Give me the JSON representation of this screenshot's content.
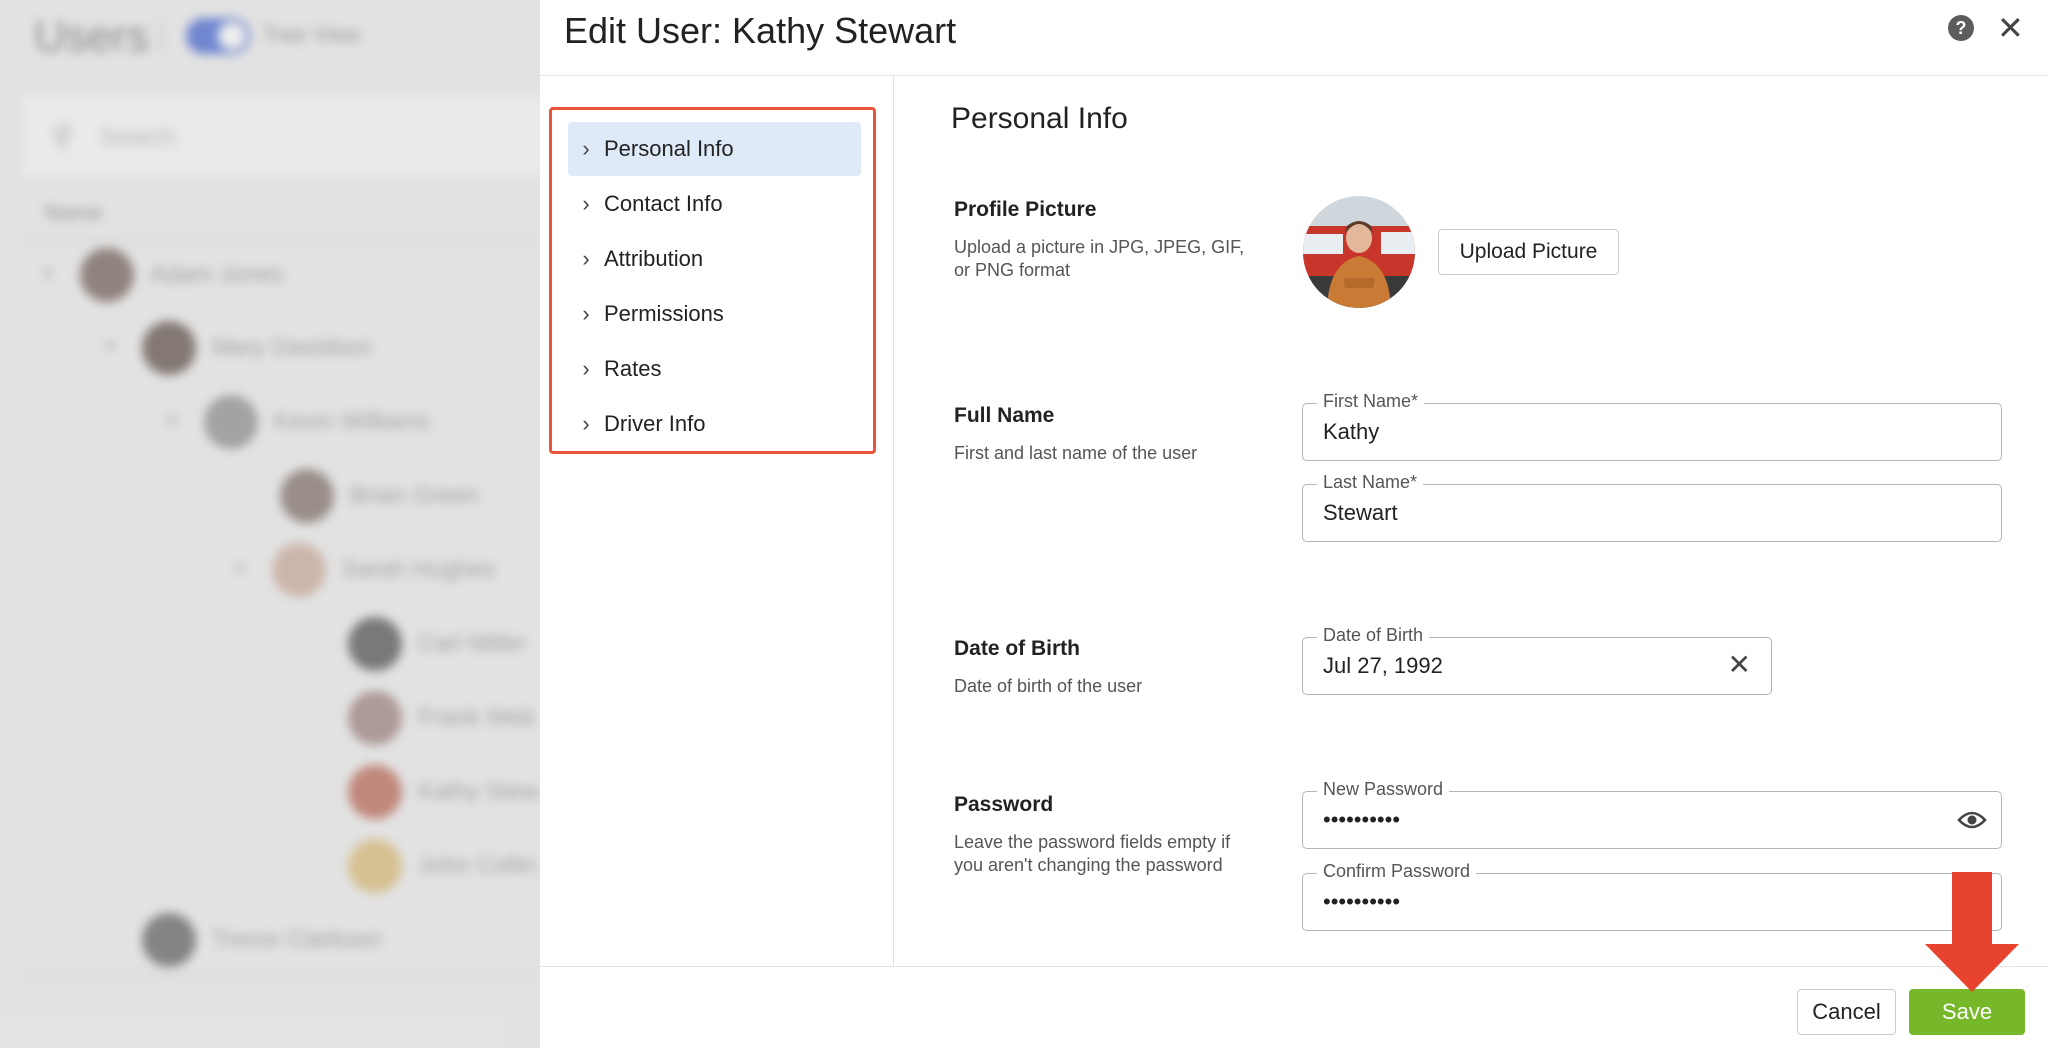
{
  "background": {
    "title": "Users",
    "toggle_label": "Tree View",
    "search_placeholder": "Search",
    "column_header": "Name",
    "users": [
      {
        "name": "Adam Jones",
        "expanded": true
      },
      {
        "name": "Mary Davidson",
        "expanded": true
      },
      {
        "name": "Kevin Williams",
        "expanded": true
      },
      {
        "name": "Brian Green",
        "expanded": false
      },
      {
        "name": "Sarah Hughes",
        "expanded": true
      },
      {
        "name": "Carl Miller",
        "expanded": false
      },
      {
        "name": "Frank Web",
        "expanded": false
      },
      {
        "name": "Kathy Stew",
        "expanded": false
      },
      {
        "name": "John Collin",
        "expanded": false
      },
      {
        "name": "Trevor Clarkson",
        "expanded": false
      }
    ]
  },
  "modal": {
    "title": "Edit User: Kathy Stewart",
    "help_icon": "question-circle-icon",
    "close_icon": "close-icon",
    "nav": [
      {
        "label": "Personal Info",
        "active": true
      },
      {
        "label": "Contact Info",
        "active": false
      },
      {
        "label": "Attribution",
        "active": false
      },
      {
        "label": "Permissions",
        "active": false
      },
      {
        "label": "Rates",
        "active": false
      },
      {
        "label": "Driver Info",
        "active": false
      }
    ],
    "section_title": "Personal Info",
    "profile_picture": {
      "label": "Profile Picture",
      "description": "Upload a picture in JPG, JPEG, GIF, or PNG format",
      "button": "Upload Picture"
    },
    "full_name": {
      "label": "Full Name",
      "description": "First and last name of the user",
      "first_name_label": "First Name*",
      "first_name_value": "Kathy",
      "last_name_label": "Last Name*",
      "last_name_value": "Stewart"
    },
    "date_of_birth": {
      "label": "Date of Birth",
      "description": "Date of birth of the user",
      "field_label": "Date of Birth",
      "value": "Jul 27, 1992"
    },
    "password": {
      "label": "Password",
      "description": "Leave the password fields empty if you aren't changing the password",
      "new_label": "New Password",
      "new_value": "••••••••••",
      "confirm_label": "Confirm Password",
      "confirm_value": "••••••••••"
    },
    "footer": {
      "cancel": "Cancel",
      "save": "Save"
    }
  },
  "colors": {
    "accent_save": "#76b82a",
    "highlight_box": "#e8553a",
    "arrow": "#e8432f",
    "nav_active_bg": "#dfeaf9"
  }
}
